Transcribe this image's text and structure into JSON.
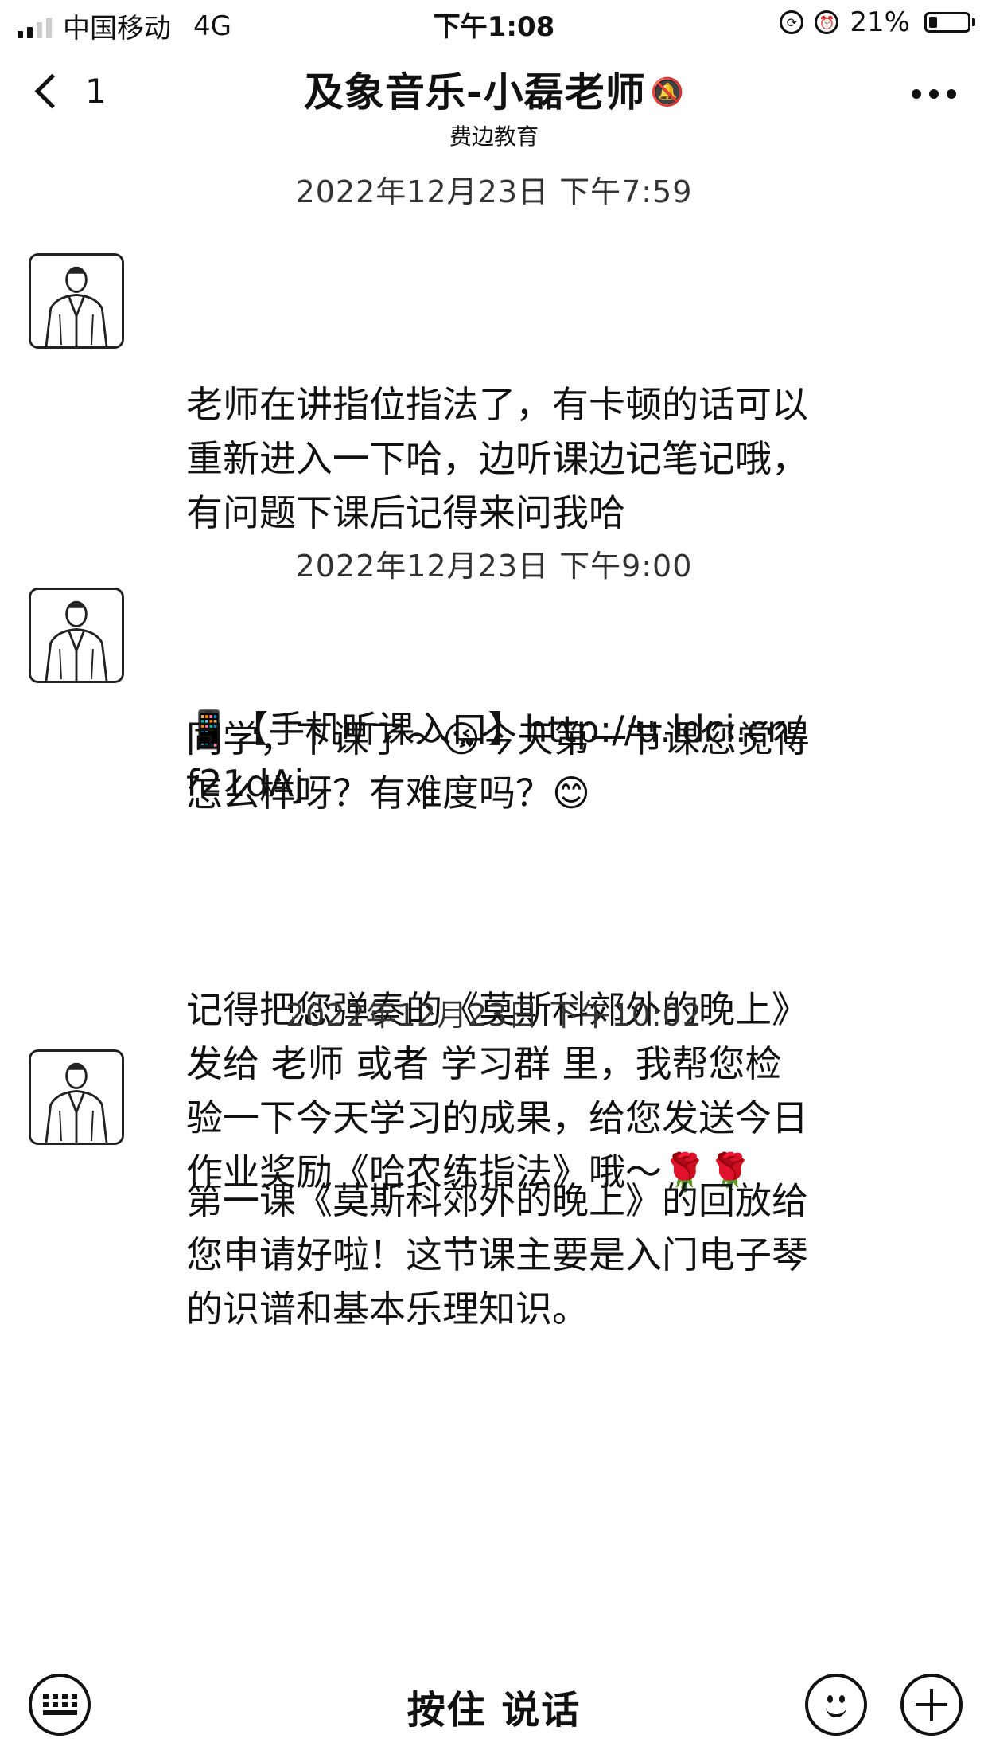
{
  "status_bar": {
    "carrier": "中国移动",
    "network": "4G",
    "time": "下午1:08",
    "battery": "21%",
    "battery_level": 0.21
  },
  "nav": {
    "back_count": "1",
    "title": "及象音乐-小磊老师",
    "subtitle": "费边教育",
    "mute_icon": "bell-muted-icon",
    "more_icon": "more-dots-icon"
  },
  "messages": [
    {
      "timestamp": "2022年12月23日 下午7:59",
      "paragraphs": [
        "老师在讲指位指法了，有卡顿的话可以重新进入一下哈，边听课边记笔记哦，有问题下课后记得来问我哈",
        "📱【手机听课入口】http://u.ldci.cn/f21dAj"
      ]
    },
    {
      "timestamp": "2022年12月23日 下午9:00",
      "paragraphs": [
        "同学，下课了～😘今天第一节课您觉得怎么样呀？有难度吗？😊",
        "记得把您弹奏的《莫斯科郊外的晚上》发给 老师 或者 学习群 里，我帮您检验一下今天学习的成果，给您发送今日作业奖励《哈农练指法》哦～🌹🌹"
      ]
    },
    {
      "timestamp": "2022年12月23日 下午10:02",
      "paragraphs": [
        "第一课《莫斯科郊外的晚上》的回放给您申请好啦！这节课主要是入门电子琴的识谱和基本乐理知识。"
      ]
    }
  ],
  "input_bar": {
    "hold_to_talk": "按住 说话",
    "keyboard_icon": "keyboard-icon",
    "emoji_icon": "emoji-icon",
    "plus_icon": "plus-icon"
  }
}
